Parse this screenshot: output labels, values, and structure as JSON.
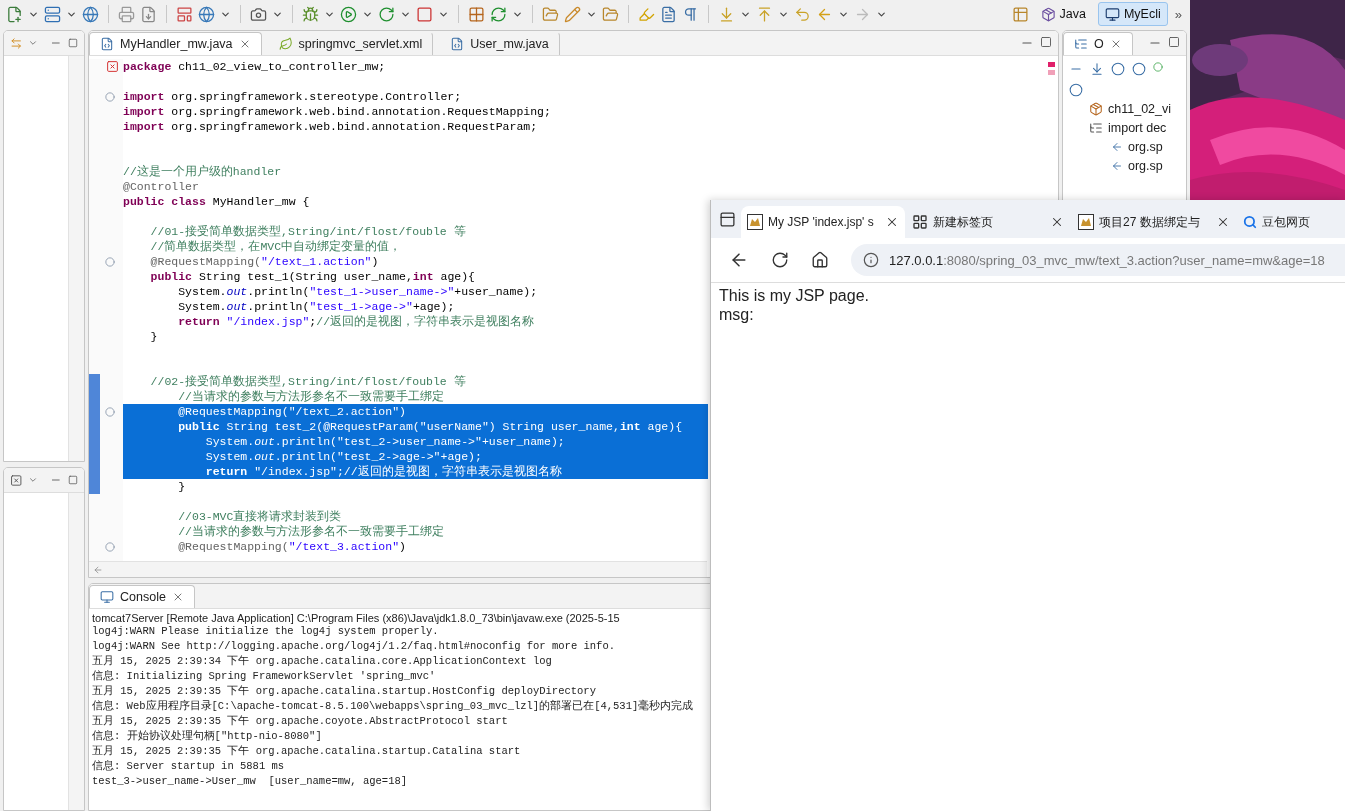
{
  "perspectives": {
    "items": [
      {
        "label": "Java",
        "selected": false
      },
      {
        "label": "MyEcli",
        "selected": true
      }
    ],
    "overflow": "»"
  },
  "editor": {
    "tabs": [
      {
        "label": "MyHandler_mw.java",
        "selected": true,
        "kind": "java"
      },
      {
        "label": "springmvc_servlet.xml",
        "selected": false,
        "kind": "xml"
      },
      {
        "label": "User_mw.java",
        "selected": false,
        "kind": "java"
      }
    ],
    "lines": [
      {
        "selected": false,
        "changed": false,
        "kind": "warning",
        "segments": [
          {
            "kind": "keyword",
            "text": "package"
          },
          {
            "kind": "plain",
            "text": " ch11_02_view_to_controller_mw;"
          }
        ]
      },
      {
        "selected": false,
        "changed": false
      },
      {
        "selected": false,
        "changed": false,
        "kind": "fold",
        "segments": [
          {
            "kind": "keyword",
            "text": "import"
          },
          {
            "kind": "plain",
            "text": " org.springframework.stereotype.Controller;"
          }
        ]
      },
      {
        "selected": false,
        "changed": false,
        "segments": [
          {
            "kind": "keyword",
            "text": "import"
          },
          {
            "kind": "plain",
            "text": " org.springframework.web.bind.annotation.RequestMapping;"
          }
        ]
      },
      {
        "selected": false,
        "changed": false,
        "segments": [
          {
            "kind": "keyword",
            "text": "import"
          },
          {
            "kind": "plain",
            "text": " org.springframework.web.bind.annotation.RequestParam;"
          }
        ]
      },
      {
        "selected": false,
        "changed": false
      },
      {
        "selected": false,
        "changed": false
      },
      {
        "selected": false,
        "changed": false,
        "segments": [
          {
            "kind": "comment",
            "text": "//这是一个用户级的handler"
          }
        ]
      },
      {
        "selected": false,
        "changed": false,
        "segments": [
          {
            "kind": "annotation",
            "text": "@Controller"
          }
        ]
      },
      {
        "selected": false,
        "changed": false,
        "segments": [
          {
            "kind": "keyword",
            "text": "public class"
          },
          {
            "kind": "plain",
            "text": " MyHandler_mw {"
          }
        ]
      },
      {
        "selected": false,
        "changed": false
      },
      {
        "selected": false,
        "changed": false,
        "segments": [
          {
            "kind": "comment",
            "text": "    //01-接受简单数据类型,String/int/flost/fouble 等"
          }
        ]
      },
      {
        "selected": false,
        "changed": false,
        "segments": [
          {
            "kind": "comment",
            "text": "    //简单数据类型，在MVC中自动绑定变量的值，"
          }
        ]
      },
      {
        "selected": false,
        "changed": false,
        "kind": "fold",
        "segments": [
          {
            "kind": "annotation",
            "text": "    @RequestMapping("
          },
          {
            "kind": "string",
            "text": "\"/text_1.action\""
          },
          {
            "kind": "plain",
            "text": ")"
          }
        ]
      },
      {
        "selected": false,
        "changed": false,
        "segments": [
          {
            "kind": "keyword",
            "text": "    public"
          },
          {
            "kind": "plain",
            "text": " String test_1(String user_name,"
          },
          {
            "kind": "keyword",
            "text": "int"
          },
          {
            "kind": "plain",
            "text": " age){"
          }
        ]
      },
      {
        "selected": false,
        "changed": false,
        "segments": [
          {
            "kind": "plain",
            "text": "        System."
          },
          {
            "kind": "field",
            "text": "out"
          },
          {
            "kind": "plain",
            "text": ".println("
          },
          {
            "kind": "string",
            "text": "\"test_1->user_name->\""
          },
          {
            "kind": "plain",
            "text": "+user_name);"
          }
        ]
      },
      {
        "selected": false,
        "changed": false,
        "segments": [
          {
            "kind": "plain",
            "text": "        System."
          },
          {
            "kind": "field",
            "text": "out"
          },
          {
            "kind": "plain",
            "text": ".println("
          },
          {
            "kind": "string",
            "text": "\"test_1->age->\""
          },
          {
            "kind": "plain",
            "text": "+age);"
          }
        ]
      },
      {
        "selected": false,
        "changed": false,
        "segments": [
          {
            "kind": "keyword",
            "text": "        return "
          },
          {
            "kind": "string",
            "text": "\"/index.jsp\""
          },
          {
            "kind": "plain",
            "text": ";"
          },
          {
            "kind": "comment",
            "text": "//返回的是视图，字符串表示是视图名称"
          }
        ]
      },
      {
        "selected": false,
        "changed": false,
        "segments": [
          {
            "kind": "plain",
            "text": "    }"
          }
        ]
      },
      {
        "selected": false,
        "changed": false
      },
      {
        "selected": false,
        "changed": false
      },
      {
        "selected": false,
        "changed": true,
        "segments": [
          {
            "kind": "comment",
            "text": "    //02-接受简单数据类型,String/int/flost/fouble 等"
          }
        ]
      },
      {
        "selected": false,
        "changed": true,
        "segments": [
          {
            "kind": "comment",
            "text": "        //当请求的参数与方法形参名不一致需要手工绑定"
          }
        ]
      },
      {
        "selected": true,
        "changed": true,
        "kind": "fold",
        "segments": [
          {
            "kind": "annotation",
            "text": "        @RequestMapping("
          },
          {
            "kind": "string",
            "text": "\"/text_2.action\""
          },
          {
            "kind": "plain",
            "text": ")"
          }
        ]
      },
      {
        "selected": true,
        "changed": true,
        "segments": [
          {
            "kind": "keyword",
            "text": "        public"
          },
          {
            "kind": "plain",
            "text": " String test_2(@RequestParam("
          },
          {
            "kind": "string",
            "text": "\"userName\""
          },
          {
            "kind": "plain",
            "text": ") String user_name,"
          },
          {
            "kind": "keyword",
            "text": "int"
          },
          {
            "kind": "plain",
            "text": " age){"
          }
        ]
      },
      {
        "selected": true,
        "changed": true,
        "segments": [
          {
            "kind": "plain",
            "text": "            System."
          },
          {
            "kind": "field",
            "text": "out"
          },
          {
            "kind": "plain",
            "text": ".println("
          },
          {
            "kind": "string",
            "text": "\"test_2->user_name->\""
          },
          {
            "kind": "plain",
            "text": "+user_name);"
          }
        ]
      },
      {
        "selected": true,
        "changed": true,
        "segments": [
          {
            "kind": "plain",
            "text": "            System."
          },
          {
            "kind": "field",
            "text": "out"
          },
          {
            "kind": "plain",
            "text": ".println("
          },
          {
            "kind": "string",
            "text": "\"test_2->age->\""
          },
          {
            "kind": "plain",
            "text": "+age);"
          }
        ]
      },
      {
        "selected": true,
        "changed": true,
        "segments": [
          {
            "kind": "keyword",
            "text": "            return "
          },
          {
            "kind": "string",
            "text": "\"/index.jsp\""
          },
          {
            "kind": "plain",
            "text": ";"
          },
          {
            "kind": "comment",
            "text": "//返回的是视图，字符串表示是视图名称"
          }
        ]
      },
      {
        "selected": false,
        "changed": true,
        "segments": [
          {
            "kind": "plain",
            "text": "        }"
          }
        ]
      },
      {
        "selected": false,
        "changed": false
      },
      {
        "selected": false,
        "changed": false,
        "segments": [
          {
            "kind": "comment",
            "text": "        //03-MVC直接将请求封装到类"
          }
        ]
      },
      {
        "selected": false,
        "changed": false,
        "segments": [
          {
            "kind": "comment",
            "text": "        //当请求的参数与方法形参名不一致需要手工绑定"
          }
        ]
      },
      {
        "selected": false,
        "changed": false,
        "kind": "fold",
        "segments": [
          {
            "kind": "annotation",
            "text": "        @RequestMapping("
          },
          {
            "kind": "string",
            "text": "\"/text_3.action\""
          },
          {
            "kind": "plain",
            "text": ")"
          }
        ]
      }
    ]
  },
  "console": {
    "tab": "Console",
    "process": "tomcat7Server [Remote Java Application] C:\\Program Files (x86)\\Java\\jdk1.8.0_73\\bin\\javaw.exe (2025-5-15",
    "lines": [
      "log4j:WARN Please initialize the log4j system properly.",
      "log4j:WARN See http://logging.apache.org/log4j/1.2/faq.html#noconfig for more info.",
      "五月 15, 2025 2:39:34 下午 org.apache.catalina.core.ApplicationContext log",
      "信息: Initializing Spring FrameworkServlet 'spring_mvc'",
      "五月 15, 2025 2:39:35 下午 org.apache.catalina.startup.HostConfig deployDirectory",
      "信息: Web应用程序目录[C:\\apache-tomcat-8.5.100\\webapps\\spring_03_mvc_lzl]的部署已在[4,531]毫秒内完成",
      "五月 15, 2025 2:39:35 下午 org.apache.coyote.AbstractProtocol start",
      "信息: 开始协议处理句柄[\"http-nio-8080\"]",
      "五月 15, 2025 2:39:35 下午 org.apache.catalina.startup.Catalina start",
      "信息: Server startup in 5881 ms",
      "test_3->user_name->User_mw  [user_name=mw, age=18]"
    ]
  },
  "outline": {
    "tab": "O",
    "items": [
      {
        "label": "ch11_02_vi",
        "kind": "package"
      },
      {
        "label": "import dec",
        "kind": "imports",
        "children": [
          {
            "label": "org.sp",
            "kind": "import"
          },
          {
            "label": "org.sp",
            "kind": "import"
          }
        ]
      }
    ]
  },
  "browser": {
    "tabs": [
      {
        "title": "My JSP 'index.jsp' s",
        "selected": true,
        "kind": "page"
      },
      {
        "title": "新建标签页",
        "selected": false,
        "kind": "newtab"
      },
      {
        "title": "项目27 数据绑定与",
        "selected": false,
        "kind": "page"
      },
      {
        "title": "豆包网页",
        "selected": false,
        "kind": "search"
      }
    ],
    "url_host": "127.0.0.1",
    "url_rest": ":8080/spring_03_mvc_mw/text_3.action?user_name=mw&age=18",
    "content": [
      "This is my JSP page.",
      "msg:"
    ]
  }
}
